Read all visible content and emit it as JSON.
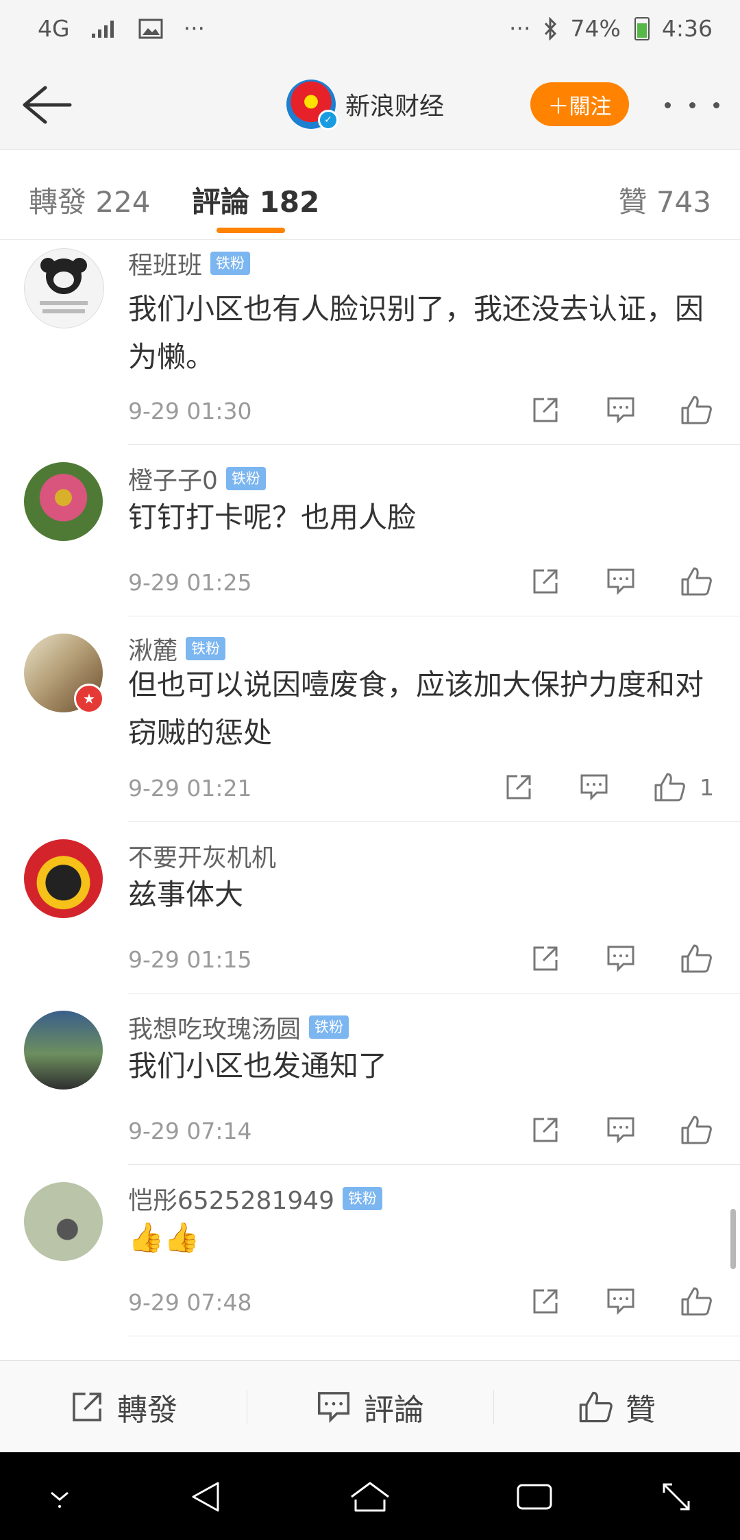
{
  "status_bar": {
    "network": "4G",
    "battery_percent": "74%",
    "time": "4:36",
    "overflow": "···"
  },
  "nav": {
    "account_name": "新浪财经",
    "follow_label": "＋關注"
  },
  "tabs": [
    {
      "label": "轉發 224"
    },
    {
      "label": "評論 182"
    },
    {
      "label": "贊 743"
    }
  ],
  "comments": [
    {
      "username": "程班班",
      "badge": "铁粉",
      "text": "我们小区也有人脸识别了，我还没去认证，因为懒。",
      "time": "9-29 01:30",
      "likes": ""
    },
    {
      "username": "橙子子0",
      "badge": "铁粉",
      "text": "钉钉打卡呢？也用人脸",
      "time": "9-29 01:25",
      "likes": ""
    },
    {
      "username": "湫麓",
      "badge": "铁粉",
      "text": "但也可以说因噎废食，应该加大保护力度和对窃贼的惩处",
      "time": "9-29 01:21",
      "likes": "1"
    },
    {
      "username": "不要开灰机机",
      "badge": "",
      "text": "兹事体大",
      "time": "9-29 01:15",
      "likes": ""
    },
    {
      "username": "我想吃玫瑰汤圆",
      "badge": "铁粉",
      "text": "我们小区也发通知了",
      "time": "9-29 07:14",
      "likes": ""
    },
    {
      "username": "恺彤6525281949",
      "badge": "铁粉",
      "text": "👍👍",
      "time": "9-29 07:48",
      "likes": ""
    }
  ],
  "bottom_bar": {
    "repost": "轉發",
    "comment": "評論",
    "like": "贊"
  }
}
